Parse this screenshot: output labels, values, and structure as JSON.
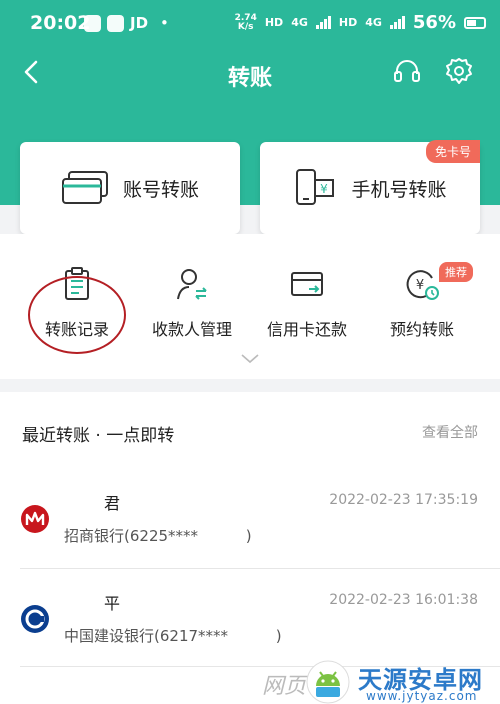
{
  "status_bar": {
    "time": "20:02",
    "apps": [
      "JD"
    ],
    "bullet": "•",
    "net_speed_value": "2.74",
    "net_speed_unit": "K/s",
    "hd1": "HD",
    "net1": "4G",
    "hd2": "HD",
    "net2": "4G",
    "battery": "56%"
  },
  "nav": {
    "title": "转账"
  },
  "cards": [
    {
      "label": "账号转账",
      "icon": "card-stack-icon"
    },
    {
      "label": "手机号转账",
      "icon": "phone-yuan-icon",
      "badge": "免卡号"
    }
  ],
  "quick_actions": [
    {
      "label": "转账记录",
      "icon": "clipboard-icon"
    },
    {
      "label": "收款人管理",
      "icon": "person-transfer-icon"
    },
    {
      "label": "信用卡还款",
      "icon": "credit-card-icon"
    },
    {
      "label": "预约转账",
      "icon": "yuan-clock-icon",
      "badge": "推荐"
    }
  ],
  "recent": {
    "title": "最近转账 · 一点即转",
    "view_all": "查看全部",
    "items": [
      {
        "name": "君",
        "time": "2022-02-23 17:35:19",
        "account": "招商银行(6225****          )",
        "bank_color": "#c8161d"
      },
      {
        "name": "平",
        "time": "2022-02-23 16:01:38",
        "account": "中国建设银行(6217****          )",
        "bank_color": "#0b3e8f"
      }
    ]
  },
  "watermark": {
    "side_text": "网页",
    "title": "天源安卓网",
    "url": "www.jytyaz.com"
  },
  "colors": {
    "brand": "#2bb89a",
    "badge": "#f06a5a",
    "highlight_circle": "#b41f24"
  }
}
